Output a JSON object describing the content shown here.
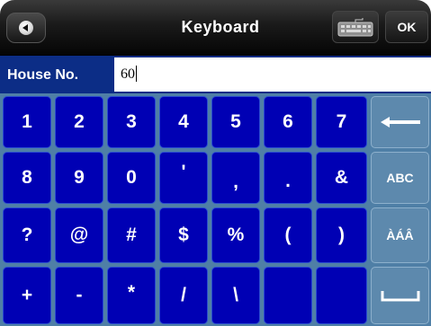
{
  "header": {
    "title": "Keyboard",
    "ok_label": "OK",
    "back_icon": "back-arrow-icon",
    "keyboard_icon": "keyboard-icon"
  },
  "input": {
    "label": "House No.",
    "value": "60"
  },
  "keyboard": {
    "rows": [
      [
        "1",
        "2",
        "3",
        "4",
        "5",
        "6",
        "7"
      ],
      [
        "8",
        "9",
        "0",
        "'",
        ",",
        ".",
        "&"
      ],
      [
        "?",
        "@",
        "#",
        "$",
        "%",
        "(",
        ")"
      ],
      [
        "+",
        "-",
        "*",
        "/",
        "\\",
        "",
        ""
      ]
    ],
    "function_keys": {
      "backspace_icon": "backspace-arrow-icon",
      "abc_label": "ABC",
      "accents_label": "ÀÁÂ",
      "space_icon": "space-icon"
    }
  },
  "colors": {
    "key_bg": "#0000b4",
    "function_key_bg": "#5d89ad",
    "input_row_bg": "#0c2d86",
    "topbar_bg": "#1a1a1a"
  }
}
